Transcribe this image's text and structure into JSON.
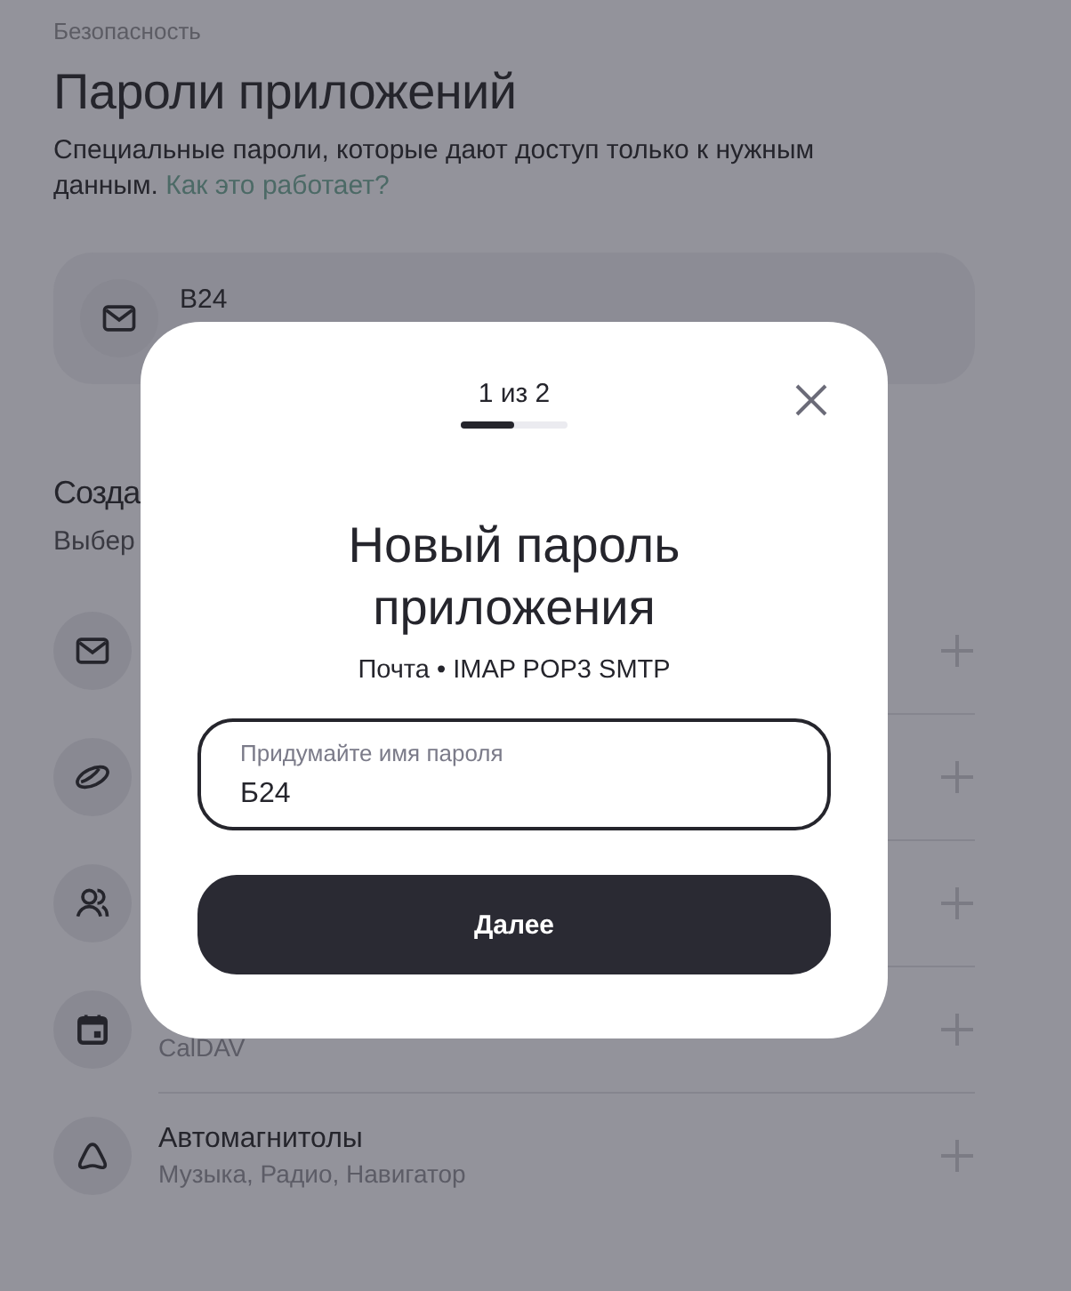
{
  "breadcrumb": "Безопасность",
  "title": "Пароли приложений",
  "description": "Специальные пароли, которые дают доступ только к нужным данным.",
  "help_link": "Как это работает?",
  "existing_passwords": [
    {
      "kind": "mail",
      "name": "B24"
    }
  ],
  "create_section": {
    "title": "Созда",
    "subtitle": "Выбер"
  },
  "app_types": [
    {
      "kind": "mail"
    },
    {
      "kind": "disk"
    },
    {
      "kind": "contacts"
    },
    {
      "kind": "calendar",
      "subtitle": "CalDAV"
    },
    {
      "kind": "car",
      "title": "Автомагнитолы",
      "subtitle": "Музыка, Радио, Навигатор"
    }
  ],
  "dialog": {
    "step": "1 из 2",
    "progress": {
      "level": 0.5
    },
    "title": "Новый пароль приложения",
    "subtitle": "Почта • IMAP POP3 SMTP",
    "field": {
      "label": "Придумайте имя пароля",
      "value": "Б24"
    },
    "button": "Далее"
  }
}
